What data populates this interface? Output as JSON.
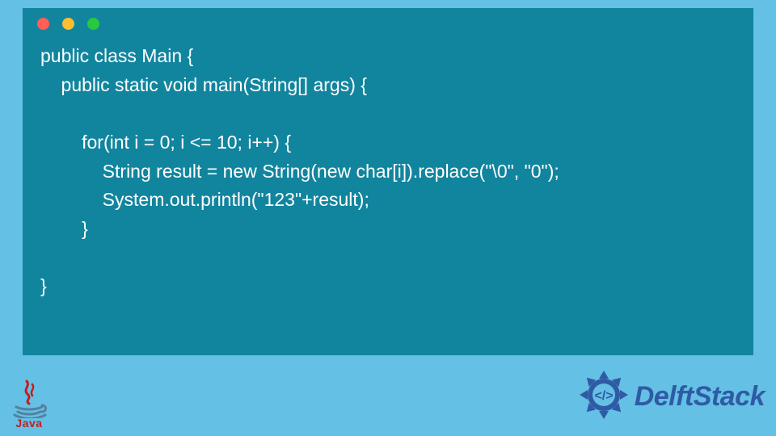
{
  "window": {
    "dots": [
      "#FF5F57",
      "#FEBC2E",
      "#28C840"
    ]
  },
  "code": {
    "lines": [
      "public class Main {",
      "    public static void main(String[] args) {",
      "",
      "        for(int i = 0; i <= 10; i++) {",
      "            String result = new String(new char[i]).replace(\"\\0\", \"0\");",
      "            System.out.println(\"123\"+result);",
      "        }",
      "",
      "}"
    ]
  },
  "logos": {
    "java_label": "Java",
    "delft_label": "DelftStack"
  },
  "colors": {
    "page_bg": "#64C0E4",
    "window_bg": "#11859E",
    "code_fg": "#ffffff",
    "java_red": "#C31D20",
    "java_blue": "#5382A1",
    "delft_blue": "#2F5BA5"
  }
}
